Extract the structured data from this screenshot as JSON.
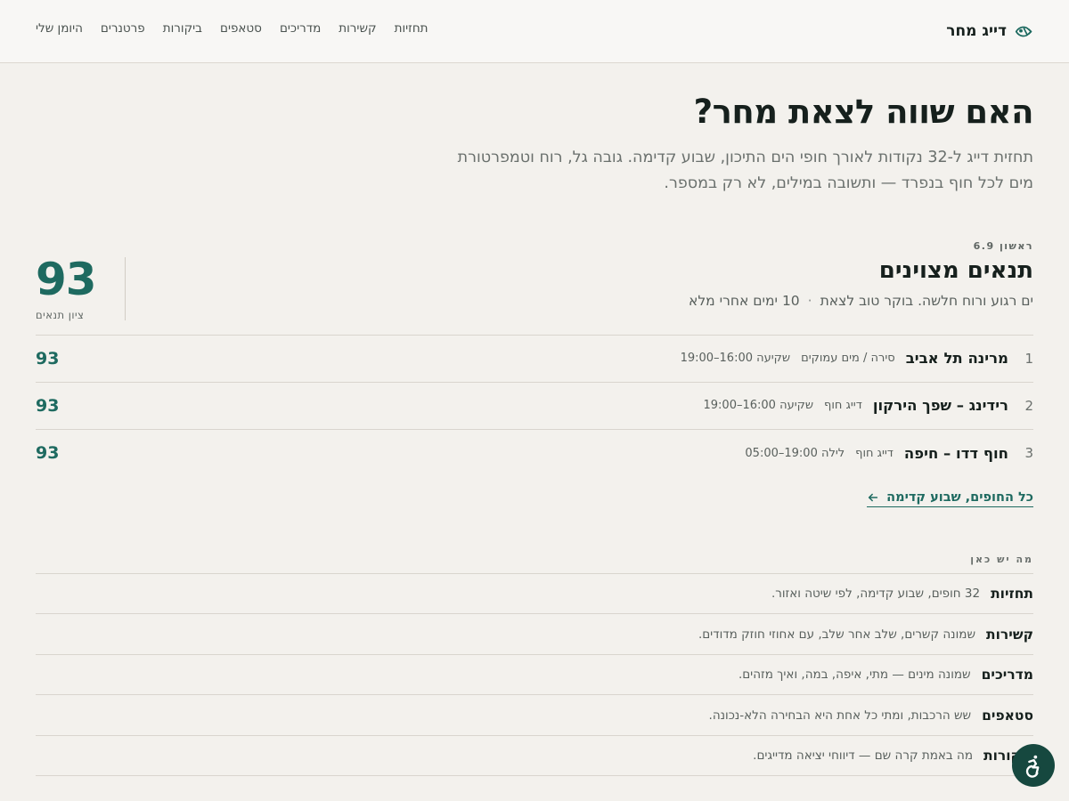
{
  "brand": {
    "name": "דייג מחר",
    "logo_icon": "fish-icon"
  },
  "nav": [
    "תחזיות",
    "קשירות",
    "מדריכים",
    "סטאפים",
    "ביקורות",
    "פרטנרים",
    "היומן שלי"
  ],
  "hero": {
    "title": "האם שווה לצאת מחר?",
    "subtitle": "תחזית דייג ל-32 נקודות לאורך חופי הים התיכון, שבוע קדימה. גובה גל, רוח וטמפרטורת מים לכל חוף בנפרד — ותשובה במילים, לא רק במספר."
  },
  "day": {
    "date": "ראשון 6.9",
    "title": "תנאים מצוינים",
    "desc": "ים רגוע ורוח חלשה. בוקר טוב לצאת",
    "moon": "10 ימים אחרי מלא",
    "score": "93",
    "score_label": "ציון תנאים"
  },
  "spots": [
    {
      "rank": "1",
      "name": "מרינה תל אביב",
      "method": "סירה / מים עמוקים",
      "window": "שקיעה 16:00–19:00",
      "score": "93"
    },
    {
      "rank": "2",
      "name": "רידינג – שפך הירקון",
      "method": "דייג חוף",
      "window": "שקיעה 16:00–19:00",
      "score": "93"
    },
    {
      "rank": "3",
      "name": "חוף דדו – חיפה",
      "method": "דייג חוף",
      "window": "לילה 19:00–05:00",
      "score": "93"
    }
  ],
  "all_link": {
    "label": "כל החופים, שבוע קדימה",
    "icon": "arrow-left-icon"
  },
  "whats_here": {
    "label": "מה יש כאן",
    "items": [
      {
        "name": "תחזיות",
        "desc": "32 חופים, שבוע קדימה, לפי שיטה ואזור."
      },
      {
        "name": "קשירות",
        "desc": "שמונה קשרים, שלב אחר שלב, עם אחוזי חוזק מדודים."
      },
      {
        "name": "מדריכים",
        "desc": "שמונה מינים — מתי, איפה, במה, ואיך מזהים."
      },
      {
        "name": "סטאפים",
        "desc": "שש הרכבות, ומתי כל אחת היא הבחירה הלא-נכונה."
      },
      {
        "name": "ביקורות",
        "desc": "מה באמת קרה שם — דיווחי יציאה מדייגים."
      }
    ]
  },
  "a11y": {
    "icon": "accessibility-icon"
  },
  "colors": {
    "accent": "#1e6a60",
    "background": "#f3f1ed",
    "header": "#f8f7f5",
    "a11y_button": "#16483f"
  }
}
